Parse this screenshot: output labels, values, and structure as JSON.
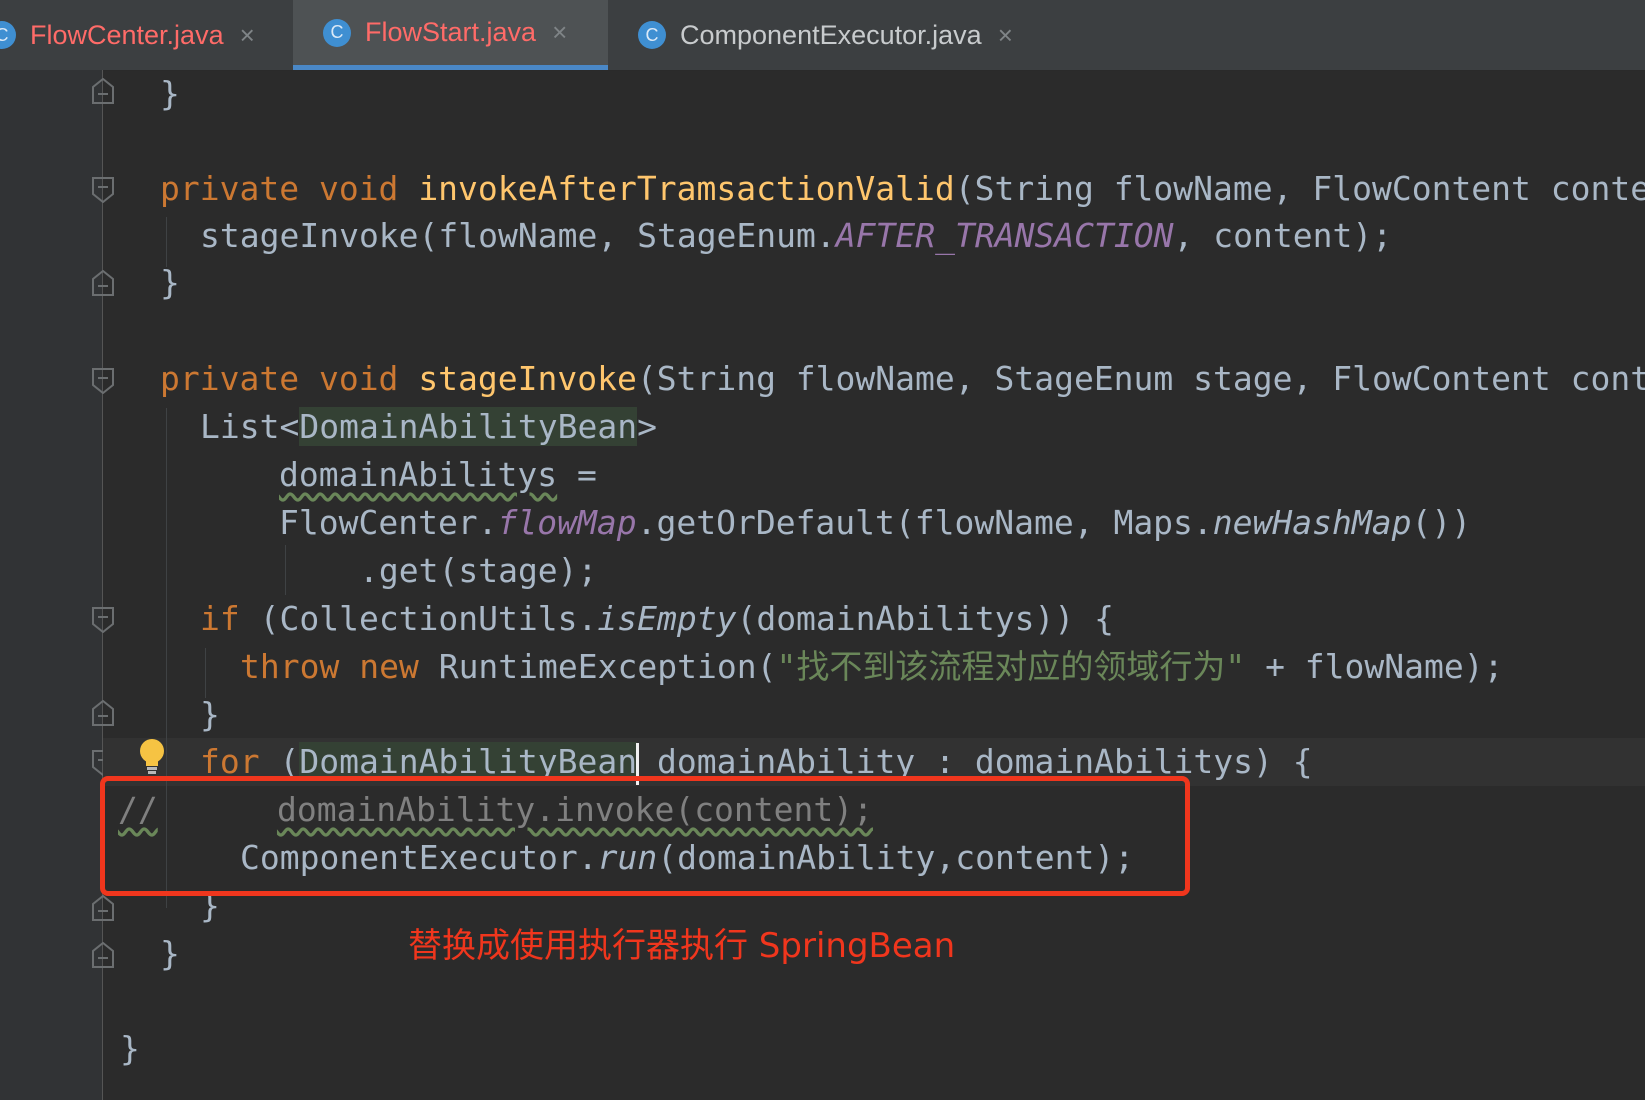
{
  "tabs": [
    {
      "label": "FlowCenter.java",
      "icon": "C",
      "close": "×",
      "active": false
    },
    {
      "label": "FlowStart.java",
      "icon": "C",
      "close": "×",
      "active": true
    },
    {
      "label": "ComponentExecutor.java",
      "icon": "C",
      "close": "×",
      "active": false
    }
  ],
  "code": {
    "l1": "}",
    "l2": {
      "kw1": "private",
      "kw2": "void",
      "fn": "invokeAfterTramsactionValid",
      "rest": "(String flowName, FlowContent conte"
    },
    "l3": {
      "a": "stageInvoke(flowName, StageEnum.",
      "st": "AFTER_TRANSACTION",
      "b": ", content);"
    },
    "l4": "}",
    "l5": {
      "kw1": "private",
      "kw2": "void",
      "fn": "stageInvoke",
      "rest": "(String flowName, StageEnum stage, FlowContent cont"
    },
    "l6": {
      "a": "List<",
      "hl": "DomainAbilityBean",
      "b": ">"
    },
    "l7": {
      "a": "domainAbilitys",
      "b": " ="
    },
    "l8": {
      "a": "FlowCenter.",
      "st": "flowMap",
      "b": ".getOrDefault(flowName, Maps.",
      "it": "newHashMap",
      "c": "())"
    },
    "l9": ".get(stage);",
    "l10": {
      "kw": "if",
      "a": " (CollectionUtils.",
      "it": "isEmpty",
      "b": "(domainAbilitys)) {"
    },
    "l11": {
      "kw1": "throw",
      "kw2": "new",
      "a": " RuntimeException(",
      "str": "\"找不到该流程对应的领域行为\"",
      "b": " + flowName);"
    },
    "l12": "}",
    "l13": {
      "kw": "for",
      "a": " (",
      "hl": "DomainAbilityBean",
      "b": " domainAbility : domainAbilitys) {"
    },
    "l14": {
      "cm1": "//",
      "cm2": "domainAbility.invoke(content);"
    },
    "l15": {
      "a": "ComponentExecutor.",
      "it": "run",
      "b": "(domainAbility,content);"
    },
    "l16": "}",
    "l17": "}",
    "l18": "}"
  },
  "annotation": "替换成使用执行器执行 SpringBean",
  "colors": {
    "background": "#2b2b2b",
    "keyword": "#cc7832",
    "method": "#ffc66d",
    "string": "#6a8759",
    "static_field": "#9876aa",
    "annotation": "#f0361d",
    "tab_accent": "#4a88c7"
  },
  "icons": [
    "class-icon",
    "close-icon",
    "fold-icon",
    "lightbulb-icon"
  ]
}
